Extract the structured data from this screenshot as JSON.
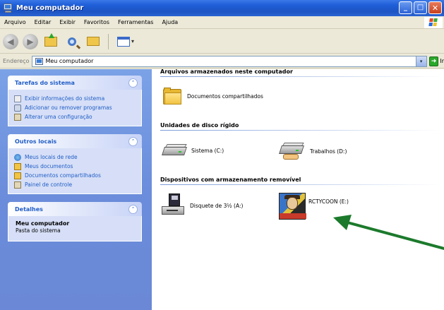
{
  "window": {
    "title": "Meu computador",
    "buttons": {
      "minimize": "_",
      "maximize": "□",
      "close": "✕"
    }
  },
  "menu": {
    "items": [
      "Arquivo",
      "Editar",
      "Exibir",
      "Favoritos",
      "Ferramentas",
      "Ajuda"
    ]
  },
  "toolbar": {
    "back_arrow": "◀",
    "forward_arrow": "▶",
    "views_chevron": "▾"
  },
  "address": {
    "label": "Endereço",
    "value": "Meu computador",
    "dropdown_glyph": "▾",
    "go_glyph": "➜",
    "go_label": "Ir"
  },
  "taskpane": {
    "system_tasks": {
      "title": "Tarefas do sistema",
      "collapse_glyph": "⌃",
      "items": [
        "Exibir informações do sistema",
        "Adicionar ou remover programas",
        "Alterar uma configuração"
      ]
    },
    "other_places": {
      "title": "Outros locais",
      "collapse_glyph": "⌃",
      "items": [
        "Meus locais de rede",
        "Meus documentos",
        "Documentos compartilhados",
        "Painel de controle"
      ]
    },
    "details": {
      "title": "Detalhes",
      "collapse_glyph": "⌃",
      "name": "Meu computador",
      "subtitle": "Pasta do sistema"
    }
  },
  "content": {
    "groups": [
      {
        "title": "Arquivos armazenados neste computador",
        "items": [
          "Documentos compartilhados"
        ]
      },
      {
        "title": "Unidades de disco rígido",
        "items": [
          "Sistema (C:)",
          "Trabalhos (D:)"
        ]
      },
      {
        "title": "Dispositivos com armazenamento removível",
        "items": [
          "Disquete de 3½ (A:)",
          "RCTYCOON (E:)"
        ]
      }
    ]
  },
  "colors": {
    "titlebar": "#1f5fd8",
    "taskpane": "#6b8ddb",
    "panel_title": "#215dc6",
    "annotation_arrow": "#1c7a2c"
  }
}
